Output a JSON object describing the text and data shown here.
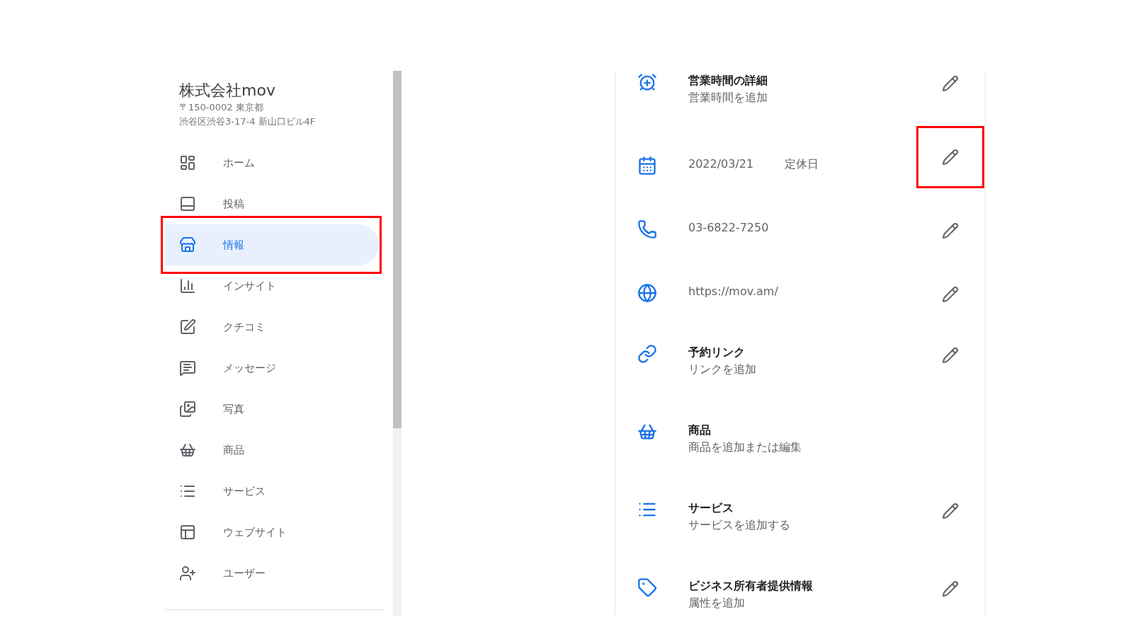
{
  "sidebar": {
    "business_name": "株式会社mov",
    "address_lines": [
      "〒150-0002 東京都",
      "渋谷区渋谷3-17-4 新山口ビル4F"
    ],
    "items": [
      {
        "label": "ホーム",
        "selected": false,
        "annotated": false
      },
      {
        "label": "投稿",
        "selected": false,
        "annotated": false
      },
      {
        "label": "情報",
        "selected": true,
        "annotated": true
      },
      {
        "label": "インサイト",
        "selected": false,
        "annotated": false
      },
      {
        "label": "クチコミ",
        "selected": false,
        "annotated": false
      },
      {
        "label": "メッセージ",
        "selected": false,
        "annotated": false
      },
      {
        "label": "写真",
        "selected": false,
        "annotated": false
      },
      {
        "label": "商品",
        "selected": false,
        "annotated": false
      },
      {
        "label": "サービス",
        "selected": false,
        "annotated": false
      },
      {
        "label": "ウェブサイト",
        "selected": false,
        "annotated": false
      },
      {
        "label": "ユーザー",
        "selected": false,
        "annotated": false
      }
    ]
  },
  "info": {
    "rows": [
      {
        "kind": "titled",
        "title": "営業時間の詳細",
        "subtitle": "営業時間を追加",
        "editable": true,
        "annotated": false
      },
      {
        "kind": "value",
        "values": [
          "2022/03/21",
          "定休日"
        ],
        "editable": true,
        "annotated": true
      },
      {
        "kind": "value",
        "values": [
          "03-6822-7250"
        ],
        "editable": true,
        "annotated": false
      },
      {
        "kind": "value",
        "values": [
          "https://mov.am/"
        ],
        "editable": true,
        "annotated": false
      },
      {
        "kind": "titled",
        "title": "予約リンク",
        "subtitle": "リンクを追加",
        "editable": true,
        "annotated": false
      },
      {
        "kind": "titled",
        "title": "商品",
        "subtitle": "商品を追加または編集",
        "editable": false,
        "annotated": false
      },
      {
        "kind": "titled",
        "title": "サービス",
        "subtitle": "サービスを追加する",
        "editable": true,
        "annotated": false
      },
      {
        "kind": "titled",
        "title": "ビジネス所有者提供情報",
        "subtitle": "属性を追加",
        "editable": true,
        "annotated": false
      }
    ]
  }
}
